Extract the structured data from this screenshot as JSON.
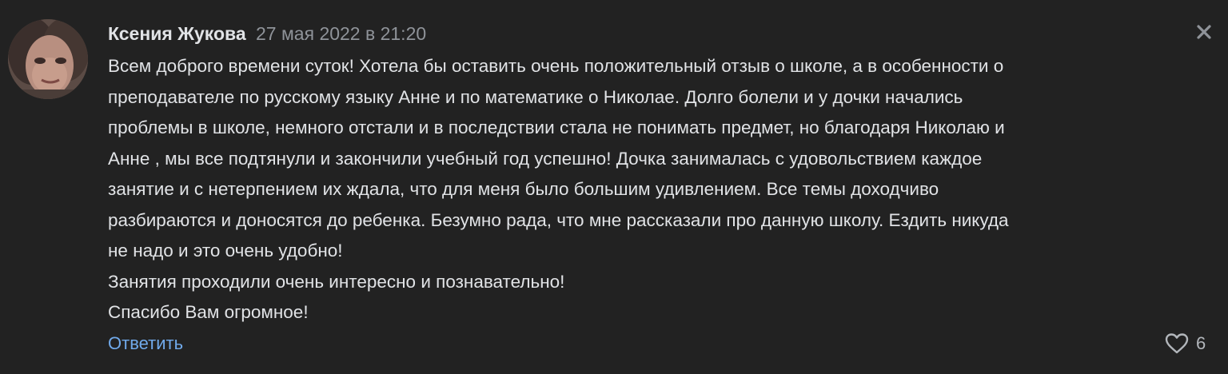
{
  "comment": {
    "author": "Ксения Жукова",
    "date": "27 мая 2022 в 21:20",
    "text_lines": [
      "Всем доброго времени суток! Хотела бы оставить очень положительный отзыв о школе, а в особенности о",
      "преподавателе по русскому языку Анне и по математике о Николае. Долго болели и у дочки начались",
      "проблемы в школе, немного отстали и в последствии стала не понимать предмет, но благодаря Николаю и",
      "Анне , мы все подтянули и закончили учебный год успешно! Дочка занималась с удовольствием каждое",
      "занятие и с нетерпением их ждала, что для меня было большим удивлением. Все темы доходчиво",
      "разбираются и доносятся до ребенка. Безумно рада, что мне рассказали про данную школу. Ездить никуда",
      "не надо и это очень удобно!",
      "Занятия проходили очень интересно и познавательно!",
      "Спасибо Вам огромное!"
    ],
    "reply_label": "Ответить",
    "like_count": "6"
  },
  "icons": {
    "close": "close-icon",
    "like": "heart-icon"
  },
  "colors": {
    "background": "#222222",
    "text": "#e1e3e6",
    "secondary": "#8f9399",
    "link": "#71aaeb"
  }
}
